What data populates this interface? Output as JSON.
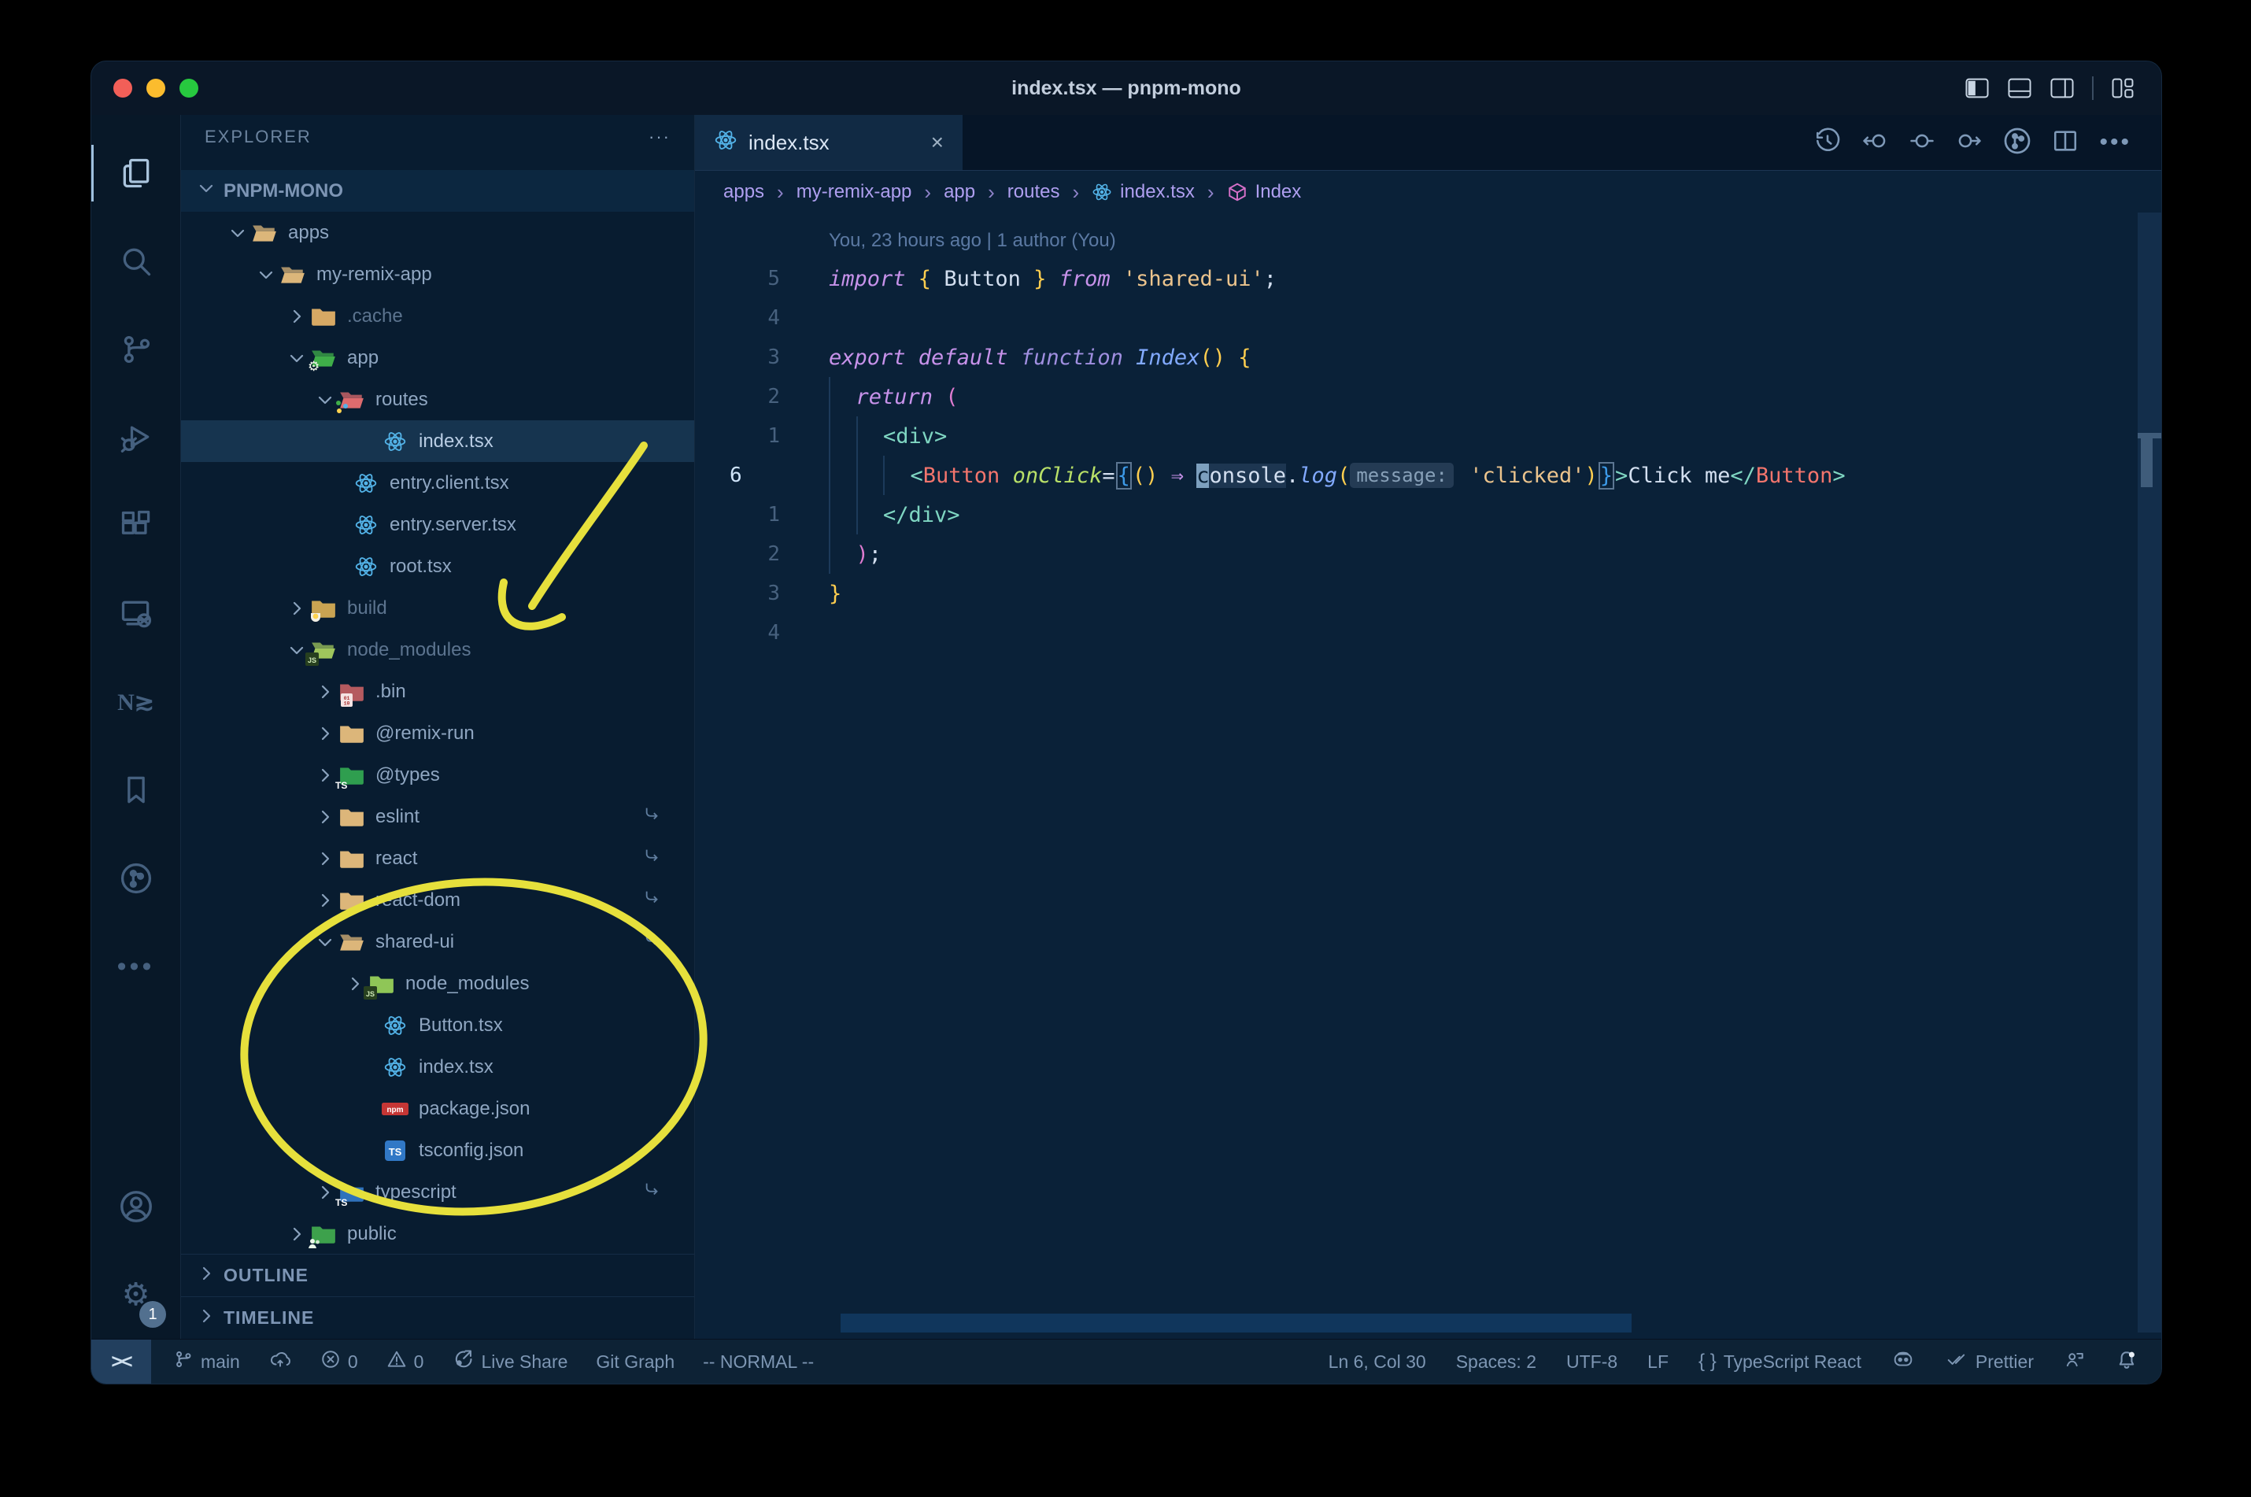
{
  "window": {
    "title": "index.tsx — pnpm-mono",
    "traffic_lights": [
      {
        "name": "close",
        "color": "#f25f58"
      },
      {
        "name": "minimize",
        "color": "#fbbc2e"
      },
      {
        "name": "zoom",
        "color": "#27c93f"
      }
    ],
    "titlebar_icons": [
      "toggle-sidebar-icon",
      "toggle-panel-icon",
      "toggle-secondary-sidebar-icon",
      "customize-layout-icon"
    ]
  },
  "activity_bar": {
    "items": [
      {
        "name": "explorer",
        "icon": "files-icon",
        "active": true
      },
      {
        "name": "search",
        "icon": "search-icon"
      },
      {
        "name": "source-control",
        "icon": "source-control-icon"
      },
      {
        "name": "run-debug",
        "icon": "run-debug-icon"
      },
      {
        "name": "extensions",
        "icon": "extensions-icon"
      },
      {
        "name": "remote-explorer",
        "icon": "remote-explorer-icon"
      },
      {
        "name": "nx-console",
        "icon": "nx-icon"
      },
      {
        "name": "bookmarks",
        "icon": "bookmark-icon"
      },
      {
        "name": "git-graph",
        "icon": "git-graph-icon"
      },
      {
        "name": "more",
        "icon": "ellipsis-icon"
      }
    ],
    "bottom_items": [
      {
        "name": "accounts",
        "icon": "account-icon"
      },
      {
        "name": "settings",
        "icon": "gear-icon",
        "badge": "1"
      }
    ]
  },
  "sidebar": {
    "header": "EXPLORER",
    "root": "PNPM-MONO",
    "sections": [
      "OUTLINE",
      "TIMELINE"
    ],
    "tree": [
      {
        "label": "apps",
        "ind": 55,
        "chev": "down",
        "icon": "folder-open",
        "color": "#dcb67a"
      },
      {
        "label": "my-remix-app",
        "ind": 91,
        "chev": "down",
        "icon": "folder-open",
        "color": "#dcb67a"
      },
      {
        "label": ".cache",
        "ind": 130,
        "chev": "right",
        "icon": "folder",
        "color": "#d7a964",
        "dim": true
      },
      {
        "label": "app",
        "ind": 130,
        "chev": "down",
        "icon": "folder-open",
        "color": "#3fae49",
        "badge": "gear"
      },
      {
        "label": "routes",
        "ind": 166,
        "chev": "down",
        "icon": "folder-open",
        "color": "#dd6b6e",
        "badge": "routes"
      },
      {
        "label": "index.tsx",
        "ind": 254,
        "icon": "react",
        "selected": true
      },
      {
        "label": "entry.client.tsx",
        "ind": 217,
        "icon": "react"
      },
      {
        "label": "entry.server.tsx",
        "ind": 217,
        "icon": "react"
      },
      {
        "label": "root.tsx",
        "ind": 217,
        "icon": "react"
      },
      {
        "label": "build",
        "ind": 130,
        "chev": "right",
        "icon": "folder",
        "color": "#c9a352",
        "dim": true,
        "badge": "build"
      },
      {
        "label": "node_modules",
        "ind": 130,
        "chev": "down",
        "icon": "folder-open",
        "color": "#9fc65c",
        "badge": "js",
        "dim": true
      },
      {
        "label": ".bin",
        "ind": 166,
        "chev": "right",
        "icon": "folder",
        "color": "#b55a5f",
        "badge": "bin"
      },
      {
        "label": "@remix-run",
        "ind": 166,
        "chev": "right",
        "icon": "folder",
        "color": "#dcb67a"
      },
      {
        "label": "@types",
        "ind": 166,
        "chev": "right",
        "icon": "folder",
        "color": "#2f9e4f",
        "badge": "ts"
      },
      {
        "label": "eslint",
        "ind": 166,
        "chev": "right",
        "icon": "folder",
        "color": "#dcb67a",
        "symlink": true
      },
      {
        "label": "react",
        "ind": 166,
        "chev": "right",
        "icon": "folder",
        "color": "#dcb67a",
        "symlink": true
      },
      {
        "label": "react-dom",
        "ind": 166,
        "chev": "right",
        "icon": "folder",
        "color": "#dcb67a",
        "symlink": true
      },
      {
        "label": "shared-ui",
        "ind": 166,
        "chev": "down",
        "icon": "folder-open",
        "color": "#dcb67a",
        "symlink": true
      },
      {
        "label": "node_modules",
        "ind": 204,
        "chev": "right",
        "icon": "folder",
        "color": "#8fc657",
        "badge": "js"
      },
      {
        "label": "Button.tsx",
        "ind": 254,
        "icon": "react"
      },
      {
        "label": "index.tsx",
        "ind": 254,
        "icon": "react"
      },
      {
        "label": "package.json",
        "ind": 254,
        "icon": "npm"
      },
      {
        "label": "tsconfig.json",
        "ind": 254,
        "icon": "tsfile"
      },
      {
        "label": "typescript",
        "ind": 166,
        "chev": "right",
        "icon": "folder",
        "color": "#2f72bc",
        "badge": "ts",
        "symlink": true
      },
      {
        "label": "public",
        "ind": 130,
        "chev": "right",
        "icon": "folder",
        "color": "#3da14c",
        "badge": "people"
      }
    ]
  },
  "editor": {
    "tab": {
      "label": "index.tsx",
      "icon": "react-icon",
      "close": "×"
    },
    "toolbar_icons": [
      "timeline-icon",
      "nav-back-icon",
      "nav-circle-icon",
      "nav-forward-icon",
      "git-actions-icon",
      "split-editor-icon",
      "more-actions-icon"
    ],
    "breadcrumbs": [
      {
        "label": "apps"
      },
      {
        "label": "my-remix-app"
      },
      {
        "label": "app"
      },
      {
        "label": "routes"
      },
      {
        "label": "index.tsx",
        "icon": "react"
      },
      {
        "label": "Index",
        "icon": "cube"
      }
    ],
    "blame": "You, 23 hours ago | 1 author (You)",
    "lines": [
      {
        "num": "5",
        "tokens": [
          {
            "c": "kw",
            "t": "import "
          },
          {
            "c": "gold",
            "t": "{"
          },
          {
            "c": "white",
            "t": " Button "
          },
          {
            "c": "gold",
            "t": "}"
          },
          {
            "c": "kw",
            "t": " from "
          },
          {
            "c": "str",
            "t": "'shared-ui'"
          },
          {
            "c": "white",
            "t": ";"
          }
        ]
      },
      {
        "num": "4",
        "tokens": []
      },
      {
        "num": "3",
        "tokens": [
          {
            "c": "kw",
            "t": "export "
          },
          {
            "c": "kw",
            "t": "default "
          },
          {
            "c": "kw2",
            "t": "function "
          },
          {
            "c": "fn",
            "t": "Index"
          },
          {
            "c": "gold",
            "t": "() {"
          }
        ]
      },
      {
        "num": "2",
        "tokens": [
          {
            "g": 1
          },
          {
            "c": "kw",
            "t": "return "
          },
          {
            "c": "pink",
            "t": "("
          }
        ]
      },
      {
        "num": "1",
        "tokens": [
          {
            "g": 2
          },
          {
            "c": "teal",
            "t": "<div>"
          }
        ]
      },
      {
        "num": "6",
        "current": true,
        "tokens": [
          {
            "g": 3
          },
          {
            "c": "teal",
            "t": "<"
          },
          {
            "c": "coral",
            "t": "Button"
          },
          {
            "c": "white",
            "t": " "
          },
          {
            "c": "attr",
            "t": "onClick"
          },
          {
            "c": "white",
            "t": "="
          },
          {
            "c": "brace boxed",
            "t": "{"
          },
          {
            "c": "gold",
            "t": "()"
          },
          {
            "c": "white",
            "t": " "
          },
          {
            "c": "kw",
            "t": "⇒"
          },
          {
            "c": "white",
            "t": " "
          },
          {
            "c": "cursor",
            "t": "c"
          },
          {
            "c": "white hl",
            "t": "onsole"
          },
          {
            "c": "white",
            "t": "."
          },
          {
            "c": "fn",
            "t": "log"
          },
          {
            "c": "gold",
            "t": "("
          },
          {
            "c": "inlay",
            "t": "message:"
          },
          {
            "c": "white",
            "t": " "
          },
          {
            "c": "str",
            "t": "'clicked'"
          },
          {
            "c": "gold",
            "t": ")"
          },
          {
            "c": "brace boxed",
            "t": "}"
          },
          {
            "c": "teal",
            "t": ">"
          },
          {
            "c": "white",
            "t": "Click me"
          },
          {
            "c": "teal",
            "t": "</"
          },
          {
            "c": "coral",
            "t": "Button"
          },
          {
            "c": "teal",
            "t": ">"
          }
        ]
      },
      {
        "num": "1",
        "tokens": [
          {
            "g": 2
          },
          {
            "c": "teal",
            "t": "</div>"
          }
        ]
      },
      {
        "num": "2",
        "tokens": [
          {
            "g": 1
          },
          {
            "c": "pink",
            "t": ")"
          },
          {
            "c": "white",
            "t": ";"
          }
        ]
      },
      {
        "num": "3",
        "tokens": [
          {
            "c": "gold",
            "t": "}"
          }
        ]
      },
      {
        "num": "4",
        "tokens": []
      }
    ]
  },
  "status_bar": {
    "remote_indicator": "><",
    "left": [
      {
        "icon": "branch",
        "label": "main"
      },
      {
        "icon": "cloud-upload",
        "label": ""
      },
      {
        "icon": "error-circle",
        "label": "0"
      },
      {
        "icon": "warning-triangle",
        "label": "0"
      },
      {
        "icon": "live-share",
        "label": "Live Share"
      },
      {
        "icon": "",
        "label": "Git Graph"
      },
      {
        "icon": "",
        "label": "-- NORMAL --"
      }
    ],
    "right": [
      {
        "icon": "",
        "label": "Ln 6, Col 30"
      },
      {
        "icon": "",
        "label": "Spaces: 2"
      },
      {
        "icon": "",
        "label": "UTF-8"
      },
      {
        "icon": "",
        "label": "LF"
      },
      {
        "icon": "braces",
        "label": "TypeScript React"
      },
      {
        "icon": "copilot",
        "label": ""
      },
      {
        "icon": "double-check",
        "label": "Prettier"
      },
      {
        "icon": "feedback",
        "label": ""
      },
      {
        "icon": "bell",
        "label": ""
      }
    ]
  },
  "annotations": {
    "color": "#e6e03c",
    "shapes": [
      "arrow-to-node-modules",
      "ellipse-around-shared-ui"
    ]
  },
  "colors": {
    "editor_bg": "#0a2138",
    "sidebar_bg": "#081c30",
    "accent_blue": "#53b3e8",
    "annotation_yellow": "#e6e03c",
    "selected_row": "#16344f",
    "string": "#ecc48d",
    "keyword": "#c792ea"
  }
}
